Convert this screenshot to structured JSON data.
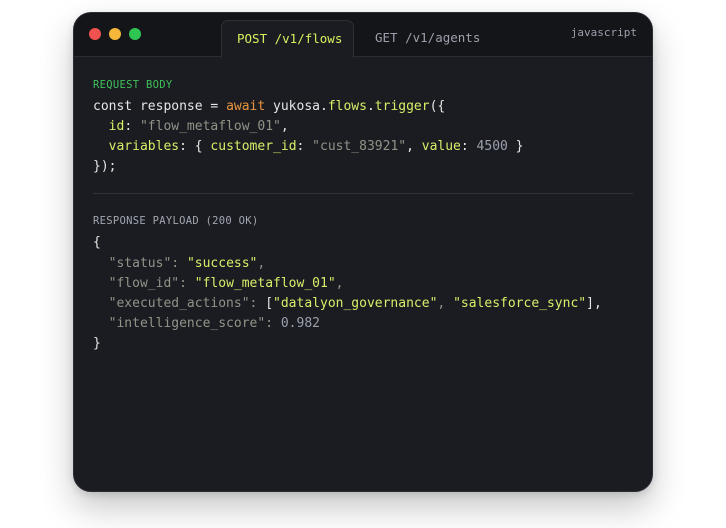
{
  "window": {
    "tabs": [
      {
        "label": "POST /v1/flows",
        "active": true
      },
      {
        "label": "GET /v1/agents",
        "active": false
      }
    ],
    "language": "javascript",
    "traffic_lights": [
      "#f0524f",
      "#f5b73a",
      "#2fc553"
    ]
  },
  "request": {
    "label": "REQUEST BODY",
    "line1": {
      "decl": "const response = ",
      "await": "await",
      "obj": " yukosa.",
      "ns": "flows",
      "dot": ".",
      "method": "trigger",
      "open": "({"
    },
    "line2": {
      "indent": "  ",
      "key": "id",
      "sep": ": ",
      "value": "\"flow_metaflow_01\"",
      "comma": ","
    },
    "line3": {
      "indent": "  ",
      "key": "variables",
      "sep": ": { ",
      "k1": "customer_id",
      "sep1": ": ",
      "v1": "\"cust_83921\"",
      "sep2": ", ",
      "k2": "value",
      "sep3": ": ",
      "v2": "4500",
      "close": " }"
    },
    "line4": "});"
  },
  "response": {
    "label": "RESPONSE PAYLOAD (200 OK)",
    "open": "{",
    "fields": [
      {
        "key": "\"status\"",
        "value": "\"success\"",
        "suffix": ","
      },
      {
        "key": "\"flow_id\"",
        "value": "\"flow_metaflow_01\"",
        "suffix": ","
      },
      {
        "key": "\"executed_actions\"",
        "value_array": [
          "\"datalyon_governance\"",
          "\"salesforce_sync\""
        ],
        "suffix": ","
      },
      {
        "key": "\"intelligence_score\"",
        "value_num": "0.982",
        "suffix": ""
      }
    ],
    "close": "}"
  }
}
